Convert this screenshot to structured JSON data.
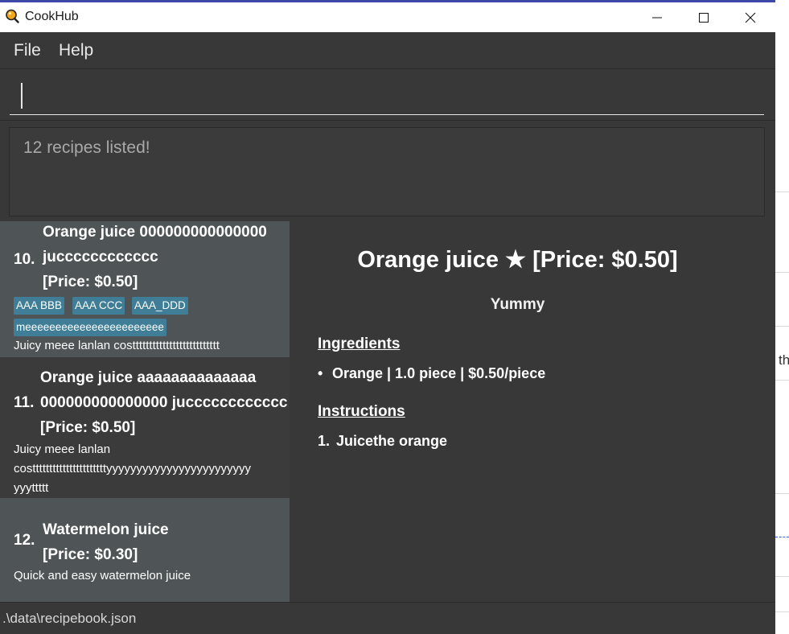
{
  "app": {
    "title": "CookHub"
  },
  "menu": {
    "file": "File",
    "help": "Help"
  },
  "command": {
    "value": ""
  },
  "result": {
    "message": "12 recipes listed!"
  },
  "recipes": [
    {
      "index": "10.",
      "name_lines": [
        "Orange juice 000000000000000",
        "jucccccccccccc",
        "[Price: $0.50]"
      ],
      "tags": [
        "AAA BBB",
        "AAA CCC",
        "AAA_DDD",
        "meeeeeeeeeeeeeeeeeeeeeee"
      ],
      "desc_lines": [
        "Juicy meee lanlan costttttttttttttttttttttttttt"
      ]
    },
    {
      "index": "11.",
      "name_lines": [
        "Orange juice aaaaaaaaaaaaaa",
        "000000000000000 jucccccccccccc",
        "[Price: $0.50]"
      ],
      "tags": [],
      "desc_lines": [
        "Juicy meee lanlan",
        "costtttttttttttttttttttttyyyyyyyyyyyyyyyyyyyyyyyy",
        "yyyttttt"
      ]
    },
    {
      "index": "12.",
      "name_lines": [
        "Watermelon juice",
        "[Price: $0.30]"
      ],
      "tags": [],
      "desc_lines": [
        "Quick and easy watermelon juice"
      ]
    }
  ],
  "detail": {
    "title": "Orange juice ★ [Price: $0.50]",
    "description": "Yummy",
    "ingredients_heading": "Ingredients",
    "ingredients": [
      "Orange | 1.0 piece | $0.50/piece"
    ],
    "instructions_heading": "Instructions",
    "instructions": [
      {
        "num": "1.",
        "text": "Juicethe orange"
      }
    ]
  },
  "status": {
    "path": ".\\data\\recipebook.json"
  },
  "background": {
    "partial_text": "th"
  },
  "colors": {
    "tag_bg": "#3f7e96",
    "selected_card_bg": "#4f5557",
    "panel_bg": "#383838",
    "title_strip": "#3d49a8"
  }
}
